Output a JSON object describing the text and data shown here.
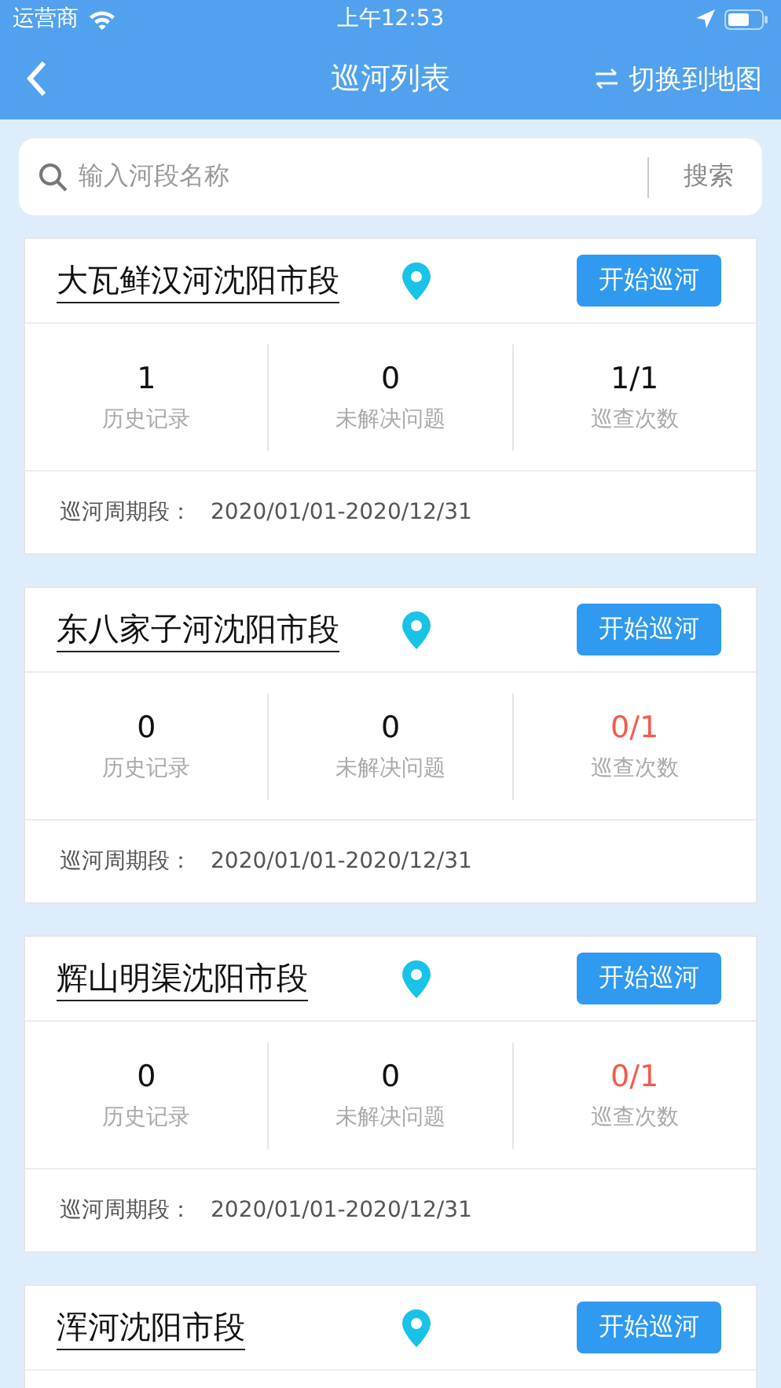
{
  "status_bar": {
    "carrier": "运营商",
    "time": "上午12:53"
  },
  "nav": {
    "title": "巡河列表",
    "action": "切换到地图"
  },
  "search": {
    "placeholder": "输入河段名称",
    "button": "搜索"
  },
  "cards": [
    {
      "name": "大瓦鲜汉河沈阳市段",
      "button": "开始巡河",
      "stats": [
        {
          "value": "1",
          "label": "历史记录",
          "alert": false
        },
        {
          "value": "0",
          "label": "未解决问题",
          "alert": false
        },
        {
          "value": "1/1",
          "label": "巡查次数",
          "alert": false
        }
      ],
      "period_label": "巡河周期段：",
      "period": "2020/01/01-2020/12/31"
    },
    {
      "name": "东八家子河沈阳市段",
      "button": "开始巡河",
      "stats": [
        {
          "value": "0",
          "label": "历史记录",
          "alert": false
        },
        {
          "value": "0",
          "label": "未解决问题",
          "alert": false
        },
        {
          "value": "0/1",
          "label": "巡查次数",
          "alert": true
        }
      ],
      "period_label": "巡河周期段：",
      "period": "2020/01/01-2020/12/31"
    },
    {
      "name": "辉山明渠沈阳市段",
      "button": "开始巡河",
      "stats": [
        {
          "value": "0",
          "label": "历史记录",
          "alert": false
        },
        {
          "value": "0",
          "label": "未解决问题",
          "alert": false
        },
        {
          "value": "0/1",
          "label": "巡查次数",
          "alert": true
        }
      ],
      "period_label": "巡河周期段：",
      "period": "2020/01/01-2020/12/31"
    },
    {
      "name": "浑河沈阳市段",
      "button": "开始巡河"
    }
  ]
}
